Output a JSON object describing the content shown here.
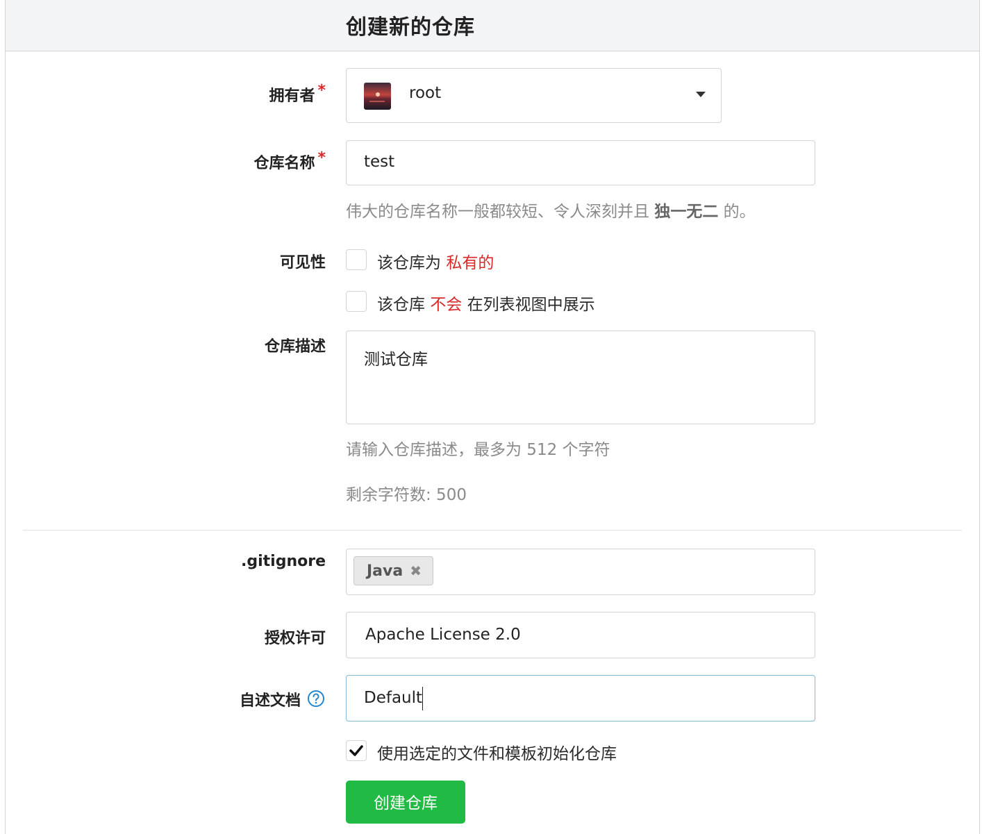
{
  "header": {
    "title": "创建新的仓库"
  },
  "owner": {
    "label": "拥有者",
    "required_mark": "*",
    "value": "root"
  },
  "repo_name": {
    "label": "仓库名称",
    "required_mark": "*",
    "value": "test",
    "help_prefix": "伟大的仓库名称一般都较短、令人深刻并且 ",
    "help_bold": "独一无二",
    "help_suffix": " 的。"
  },
  "visibility": {
    "label": "可见性",
    "private_checked": false,
    "private_prefix": "该仓库为 ",
    "private_highlight": "私有的",
    "unlisted_checked": false,
    "unlisted_prefix": "该仓库 ",
    "unlisted_highlight": "不会",
    "unlisted_suffix": " 在列表视图中展示"
  },
  "description": {
    "label": "仓库描述",
    "value": "测试仓库",
    "help": "请输入仓库描述，最多为 512 个字符",
    "remaining": "剩余字符数: 500"
  },
  "gitignore": {
    "label": ".gitignore",
    "tags": [
      "Java"
    ],
    "remove_glyph": "✖"
  },
  "license": {
    "label": "授权许可",
    "value": "Apache License 2.0"
  },
  "readme": {
    "label": "自述文档",
    "value": "Default"
  },
  "auto_init": {
    "checked": true,
    "label": "使用选定的文件和模板初始化仓库"
  },
  "submit": {
    "label": "创建仓库"
  },
  "colors": {
    "accent_green": "#21ba45",
    "warning_red": "#db2828",
    "help_blue": "#2185d0"
  }
}
